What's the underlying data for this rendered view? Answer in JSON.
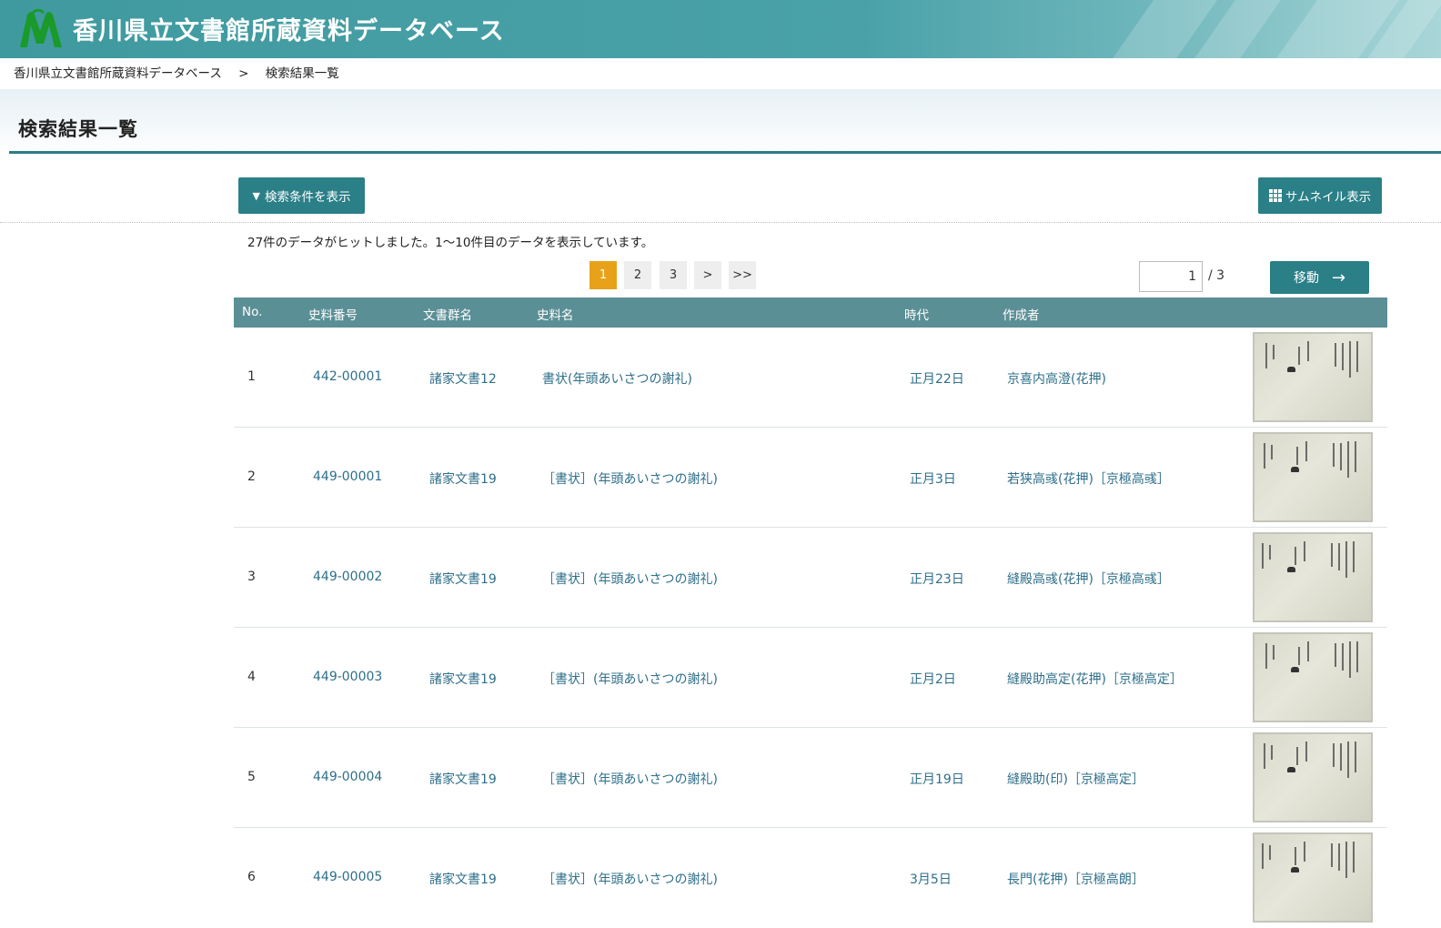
{
  "header": {
    "site_title": "香川県立文書館所蔵資料データベース",
    "colors": {
      "header_bg": "#4aa2a8",
      "accent": "#2b7f87",
      "active_page": "#e8a21a",
      "table_header": "#5b8f96"
    }
  },
  "breadcrumb": {
    "home": "香川県立文書館所蔵資料データベース",
    "separator": ">",
    "current": "検索結果一覧"
  },
  "page_title": "検索結果一覧",
  "toolbar": {
    "show_conditions_label": "検索条件を表示",
    "show_conditions_icon": "▼",
    "thumbnail_view_label": "サムネイル表示",
    "thumbnail_view_icon": "grid-icon"
  },
  "results_summary": "27件のデータがヒットしました。1〜10件目のデータを表示しています。",
  "pagination": {
    "pages": [
      "1",
      "2",
      "3"
    ],
    "active": "1",
    "next": ">",
    "last": ">>",
    "current_input": "1",
    "total": "/ 3",
    "go_label": "移動",
    "go_icon": "→"
  },
  "table": {
    "headers": {
      "no": "No.",
      "id": "史料番号",
      "group": "文書群名",
      "name": "史料名",
      "era": "時代",
      "author": "作成者"
    },
    "rows": [
      {
        "no": "1",
        "id": "442-00001",
        "group": "諸家文書12",
        "name": "書状(年頭あいさつの謝礼)",
        "era": "正月22日",
        "author": "京喜内高澄(花押)"
      },
      {
        "no": "2",
        "id": "449-00001",
        "group": "諸家文書19",
        "name": "［書状］(年頭あいさつの謝礼)",
        "era": "正月3日",
        "author": "若狭高彧(花押)［京極高彧］"
      },
      {
        "no": "3",
        "id": "449-00002",
        "group": "諸家文書19",
        "name": "［書状］(年頭あいさつの謝礼)",
        "era": "正月23日",
        "author": "縫殿高彧(花押)［京極高彧］"
      },
      {
        "no": "4",
        "id": "449-00003",
        "group": "諸家文書19",
        "name": "［書状］(年頭あいさつの謝礼)",
        "era": "正月2日",
        "author": "縫殿助高定(花押)［京極高定］"
      },
      {
        "no": "5",
        "id": "449-00004",
        "group": "諸家文書19",
        "name": "［書状］(年頭あいさつの謝礼)",
        "era": "正月19日",
        "author": "縫殿助(印)［京極高定］"
      },
      {
        "no": "6",
        "id": "449-00005",
        "group": "諸家文書19",
        "name": "［書状］(年頭あいさつの謝礼)",
        "era": "3月5日",
        "author": "長門(花押)［京極高朗］"
      }
    ]
  }
}
